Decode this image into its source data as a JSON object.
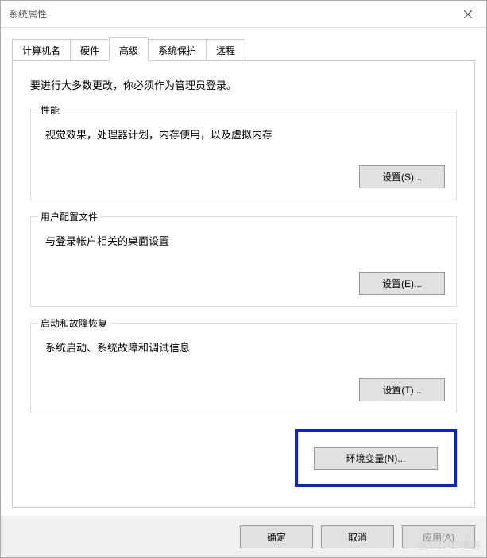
{
  "window": {
    "title": "系统属性"
  },
  "tabs": [
    {
      "label": "计算机名"
    },
    {
      "label": "硬件"
    },
    {
      "label": "高级"
    },
    {
      "label": "系统保护"
    },
    {
      "label": "远程"
    }
  ],
  "panel": {
    "info": "要进行大多数更改，你必须作为管理员登录。",
    "groups": {
      "performance": {
        "legend": "性能",
        "desc": "视觉效果，处理器计划，内存使用，以及虚拟内存",
        "button": "设置(S)..."
      },
      "userprofile": {
        "legend": "用户配置文件",
        "desc": "与登录帐户相关的桌面设置",
        "button": "设置(E)..."
      },
      "startup": {
        "legend": "启动和故障恢复",
        "desc": "系统启动、系统故障和调试信息",
        "button": "设置(T)..."
      }
    },
    "envButton": "环境变量(N)..."
  },
  "footer": {
    "ok": "确定",
    "cancel": "取消",
    "apply": "应用(A)"
  },
  "watermark": "@51CTO博客"
}
